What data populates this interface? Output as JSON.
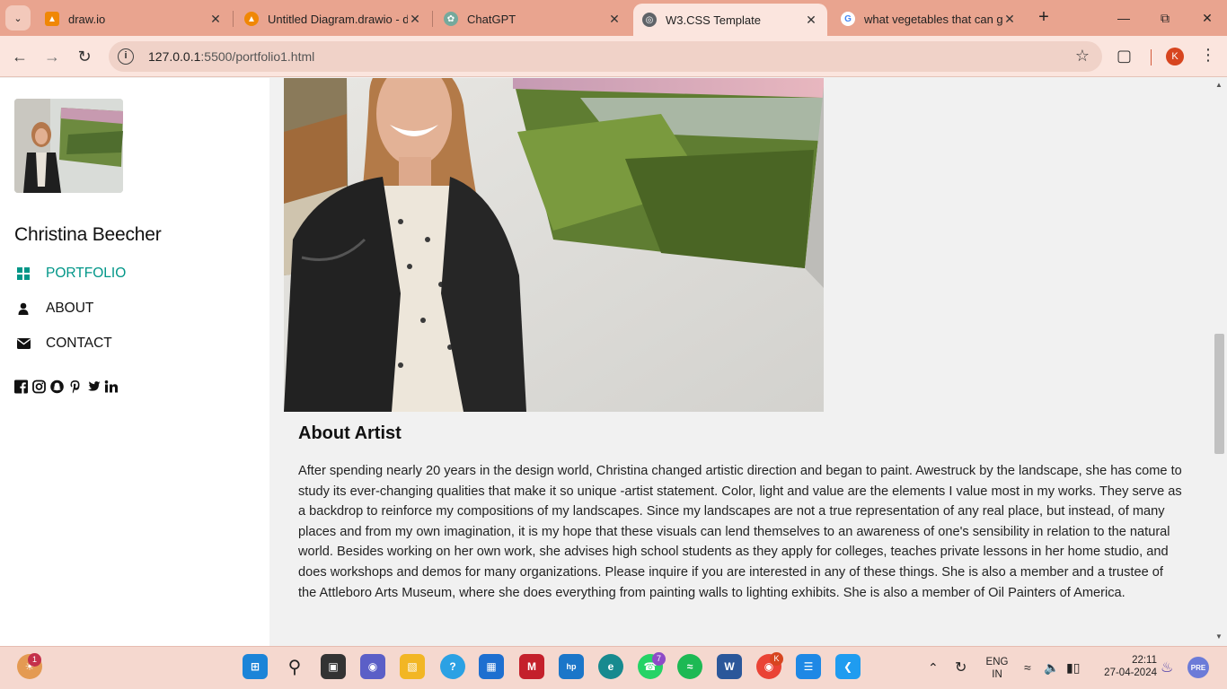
{
  "browser": {
    "tabs": [
      {
        "title": "draw.io",
        "icon": "drawio-icon",
        "active": false
      },
      {
        "title": "Untitled Diagram.drawio - d",
        "icon": "drawio-icon",
        "active": false
      },
      {
        "title": "ChatGPT",
        "icon": "chatgpt-icon",
        "active": false
      },
      {
        "title": "W3.CSS Template",
        "icon": "globe-icon",
        "active": true
      },
      {
        "title": "what vegetables that can g",
        "icon": "google-icon",
        "active": false
      }
    ],
    "url_host": "127.0.0.1",
    "url_rest": ":5500/portfolio1.html",
    "profile_initial": "K",
    "colors": {
      "frame": "#e9a48f",
      "toolbar": "#fbe5de",
      "omnibox": "#f0d2c8"
    }
  },
  "sidebar": {
    "artist_name": "Christina Beecher",
    "nav": [
      {
        "label": "PORTFOLIO",
        "icon": "grid-icon",
        "active": true
      },
      {
        "label": "ABOUT",
        "icon": "user-icon",
        "active": false
      },
      {
        "label": "CONTACT",
        "icon": "envelope-icon",
        "active": false
      }
    ],
    "social": [
      "facebook-icon",
      "instagram-icon",
      "snapchat-icon",
      "pinterest-icon",
      "twitter-icon",
      "linkedin-icon"
    ],
    "accent": "#009688"
  },
  "main": {
    "about_title": "About Artist",
    "about_text": "After spending nearly 20 years in the design world, Christina changed artistic direction and began to paint. Awestruck by the landscape, she has come to study its ever-changing qualities that make it so unique -artist statement. Color, light and value are the elements I value most in my works. They serve as a backdrop to reinforce my compositions of my landscapes. Since my landscapes are not a true representation of any real place, but instead, of many places and from my own imagination, it is my hope that these visuals can lend themselves to an awareness of one's sensibility in relation to the natural world. Besides working on her own work, she advises high school students as they apply for colleges, teaches private lessons in her home studio, and does workshops and demos for many organizations. Please inquire if you are interested in any of these things. She is also a member and a trustee of the Attleboro Arts Museum, where she does everything from painting walls to lighting exhibits. She is also a member of Oil Painters of America."
  },
  "taskbar": {
    "weather_badge": "1",
    "whatsapp_badge": "7",
    "chrome_badge": "K",
    "language": "ENG",
    "region": "IN",
    "time": "22:11",
    "date": "27-04-2024"
  }
}
